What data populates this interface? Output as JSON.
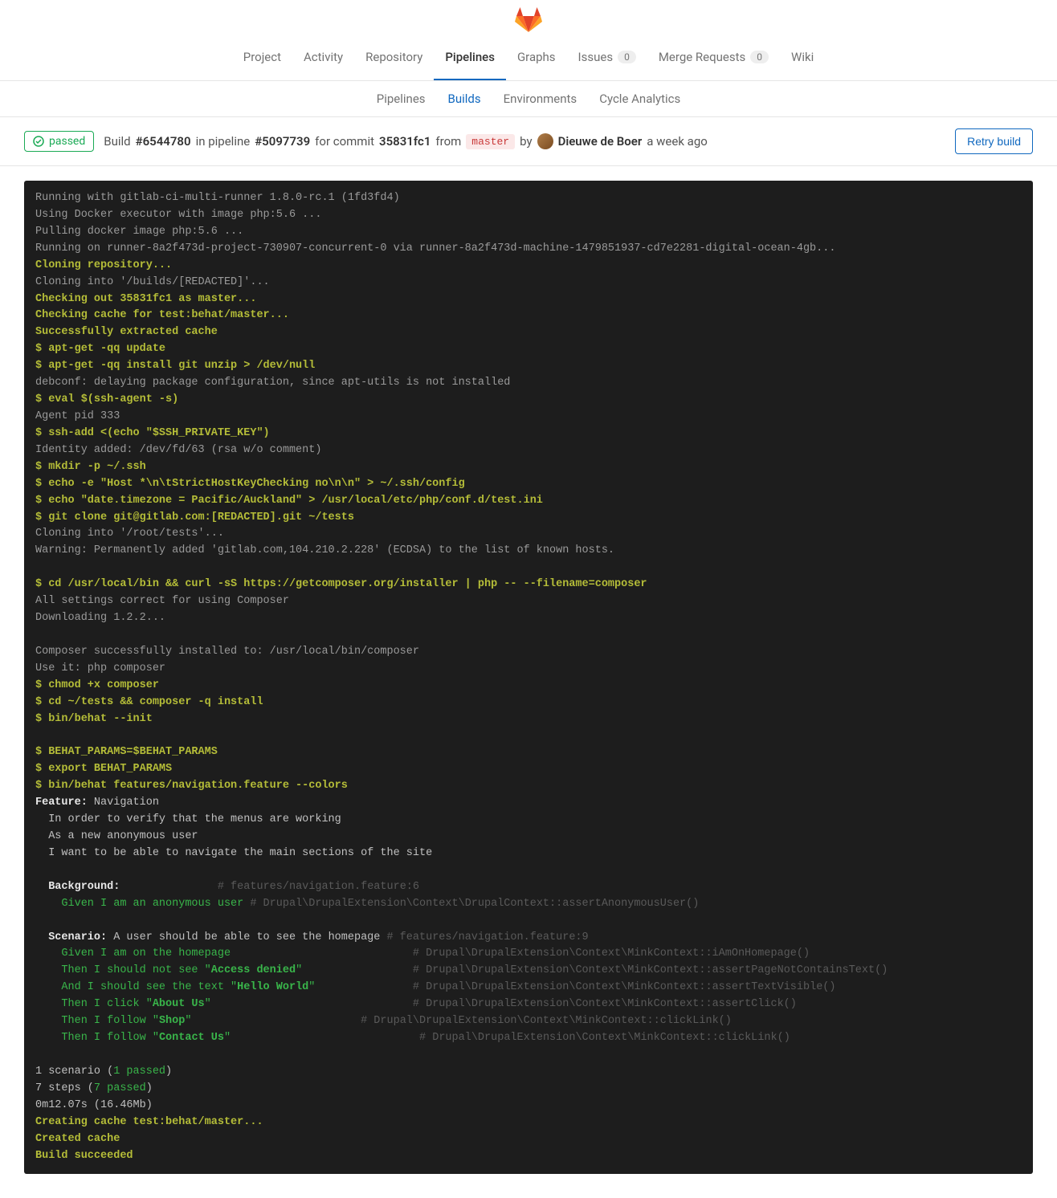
{
  "nav": {
    "project": "Project",
    "activity": "Activity",
    "repository": "Repository",
    "pipelines": "Pipelines",
    "graphs": "Graphs",
    "issues": "Issues",
    "issues_count": "0",
    "merge_requests": "Merge Requests",
    "mr_count": "0",
    "wiki": "Wiki"
  },
  "subnav": {
    "pipelines": "Pipelines",
    "builds": "Builds",
    "environments": "Environments",
    "cycle": "Cycle Analytics"
  },
  "status": {
    "label": "passed"
  },
  "header": {
    "build": "Build ",
    "build_id": "#6544780",
    "in_pipeline": " in pipeline ",
    "pipeline_id": "#5097739",
    "for_commit": " for commit ",
    "commit": "35831fc1",
    "from": " from ",
    "branch": "master",
    "by": " by ",
    "author": "Dieuwe de Boer",
    "time": " a week ago"
  },
  "actions": {
    "retry": "Retry build"
  },
  "log": {
    "l1": "Running with gitlab-ci-multi-runner 1.8.0-rc.1 (1fd3fd4)",
    "l2": "Using Docker executor with image php:5.6 ...",
    "l3": "Pulling docker image php:5.6 ...",
    "l4": "Running on runner-8a2f473d-project-730907-concurrent-0 via runner-8a2f473d-machine-1479851937-cd7e2281-digital-ocean-4gb...",
    "l5": "Cloning repository...",
    "l6": "Cloning into '/builds/[REDACTED]'...",
    "l7": "Checking out 35831fc1 as master...",
    "l8": "Checking cache for test:behat/master...",
    "l9": "Successfully extracted cache",
    "l10": "$ apt-get -qq update",
    "l11": "$ apt-get -qq install git unzip > /dev/null",
    "l12": "debconf: delaying package configuration, since apt-utils is not installed",
    "l13": "$ eval $(ssh-agent -s)",
    "l14": "Agent pid 333",
    "l15": "$ ssh-add <(echo \"$SSH_PRIVATE_KEY\")",
    "l16": "Identity added: /dev/fd/63 (rsa w/o comment)",
    "l17": "$ mkdir -p ~/.ssh",
    "l18": "$ echo -e \"Host *\\n\\tStrictHostKeyChecking no\\n\\n\" > ~/.ssh/config",
    "l19": "$ echo \"date.timezone = Pacific/Auckland\" > /usr/local/etc/php/conf.d/test.ini",
    "l20": "$ git clone git@gitlab.com:[REDACTED].git ~/tests",
    "l21": "Cloning into '/root/tests'...",
    "l22": "Warning: Permanently added 'gitlab.com,104.210.2.228' (ECDSA) to the list of known hosts.",
    "l23": "$ cd /usr/local/bin && curl -sS https://getcomposer.org/installer | php -- --filename=composer",
    "l24": "All settings correct for using Composer",
    "l25": "Downloading 1.2.2...",
    "l26": "Composer successfully installed to: /usr/local/bin/composer",
    "l27": "Use it: php composer",
    "l28": "$ chmod +x composer",
    "l29": "$ cd ~/tests && composer -q install",
    "l30": "$ bin/behat --init",
    "l31": "$ BEHAT_PARAMS=$BEHAT_PARAMS",
    "l32": "$ export BEHAT_PARAMS",
    "l33": "$ bin/behat features/navigation.feature --colors",
    "l34a": "Feature:",
    "l34b": " Navigation",
    "l35": "  In order to verify that the menus are working",
    "l36": "  As a new anonymous user",
    "l37": "  I want to be able to navigate the main sections of the site",
    "l38a": "  Background:",
    "l38b": "               ",
    "l38c": "# features/navigation.feature:6",
    "l39a": "    Given I am an anonymous user",
    "l39b": " ",
    "l39c": "# Drupal\\DrupalExtension\\Context\\DrupalContext::assertAnonymousUser()",
    "l40a": "  Scenario:",
    "l40b": " A user should be able to see the homepage ",
    "l40c": "# features/navigation.feature:9",
    "l41a": "    Given I am on the homepage",
    "l41b": "                            ",
    "l41c": "# Drupal\\DrupalExtension\\Context\\MinkContext::iAmOnHomepage()",
    "l42a": "    Then I should not see \"",
    "l42b": "Access denied",
    "l42c": "\"",
    "l42d": "                 ",
    "l42e": "# Drupal\\DrupalExtension\\Context\\MinkContext::assertPageNotContainsText()",
    "l43a": "    And I should see the text \"",
    "l43b": "Hello World",
    "l43c": "\"",
    "l43d": "               ",
    "l43e": "# Drupal\\DrupalExtension\\Context\\MinkContext::assertTextVisible()",
    "l44a": "    Then I click \"",
    "l44b": "About Us",
    "l44c": "\"",
    "l44d": "                               ",
    "l44e": "# Drupal\\DrupalExtension\\Context\\MinkContext::assertClick()",
    "l45a": "    Then I follow \"",
    "l45b": "Shop",
    "l45c": "\"",
    "l45d": "                          ",
    "l45e": "# Drupal\\DrupalExtension\\Context\\MinkContext::clickLink()",
    "l46a": "    Then I follow \"",
    "l46b": "Contact Us",
    "l46c": "\"",
    "l46d": "                             ",
    "l46e": "# Drupal\\DrupalExtension\\Context\\MinkContext::clickLink()",
    "l47a": "1 scenario (",
    "l47b": "1 passed",
    "l47c": ")",
    "l48a": "7 steps (",
    "l48b": "7 passed",
    "l48c": ")",
    "l49": "0m12.07s (16.46Mb)",
    "l50": "Creating cache test:behat/master...",
    "l51": "Created cache",
    "l52": "Build succeeded"
  }
}
